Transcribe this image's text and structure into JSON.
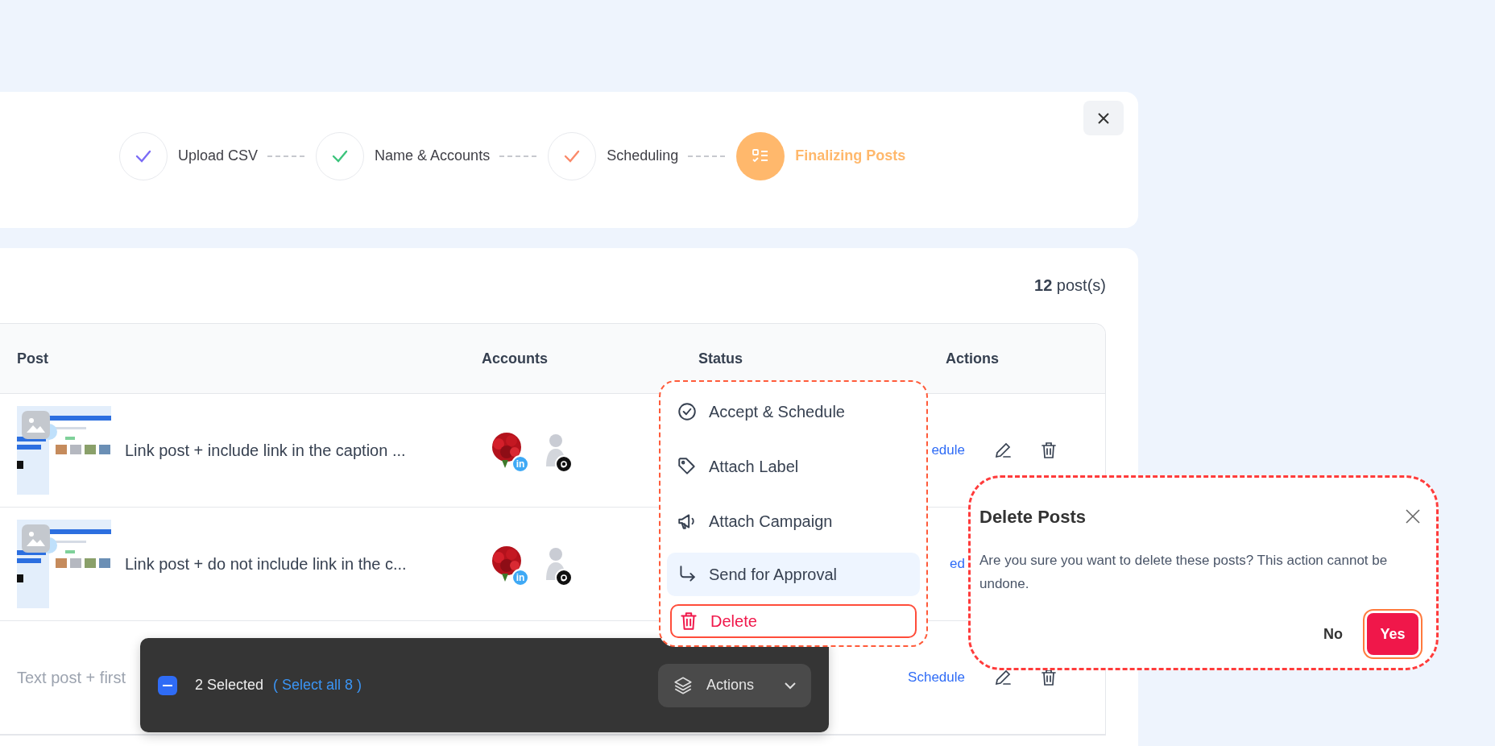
{
  "stepper": {
    "steps": [
      {
        "label": "Upload CSV",
        "done": true,
        "color": "#7b6cf6"
      },
      {
        "label": "Name & Accounts",
        "done": true,
        "color": "#3cc47c"
      },
      {
        "label": "Scheduling",
        "done": true,
        "color": "#fa8a6a"
      },
      {
        "label": "Finalizing Posts",
        "done": false,
        "color": "#ffb86c"
      }
    ]
  },
  "posts_count": "**12** post(s)",
  "table": {
    "columns": [
      "Post",
      "Accounts",
      "Status",
      "Actions"
    ],
    "rows": [
      {
        "kind": "media",
        "dimmed": false,
        "caption": "Link post + include link in the caption ...",
        "accounts": [
          {
            "badge": "in"
          },
          {
            "kind": "silhouette"
          }
        ],
        "action_link": "edule",
        "tools": true
      },
      {
        "kind": "media",
        "dimmed": false,
        "caption": "Link post + do not include link in the c...",
        "accounts": [
          {
            "badge": "in"
          },
          {
            "kind": "silhouette"
          }
        ],
        "action_link": "ed",
        "tools": false
      },
      {
        "kind": "text",
        "dimmed": true,
        "caption": "Text post + first",
        "accounts": [],
        "action_link": "Schedule",
        "tools": true
      }
    ]
  },
  "actions_menu": {
    "items": [
      {
        "label": "Accept & Schedule",
        "kind": "normal",
        "highlighted": false
      },
      {
        "label": "Attach Label",
        "kind": "normal",
        "highlighted": false
      },
      {
        "label": "Attach Campaign",
        "kind": "normal",
        "highlighted": false
      },
      {
        "label": "Send for Approval",
        "kind": "normal",
        "highlighted": true
      },
      {
        "label": "Delete",
        "kind": "danger",
        "highlighted": false
      }
    ]
  },
  "selection_bar": {
    "indeterminate": true,
    "selected": "2 Selected",
    "select_all": "( Select all 8 )",
    "actions_button": "Actions"
  },
  "dialog": {
    "title": "Delete Posts",
    "message": "Are you sure you want to delete these posts? This action cannot be undone.",
    "buttons": [
      {
        "label": "No",
        "kind": "text"
      },
      {
        "label": "Yes",
        "kind": "primary"
      }
    ]
  }
}
